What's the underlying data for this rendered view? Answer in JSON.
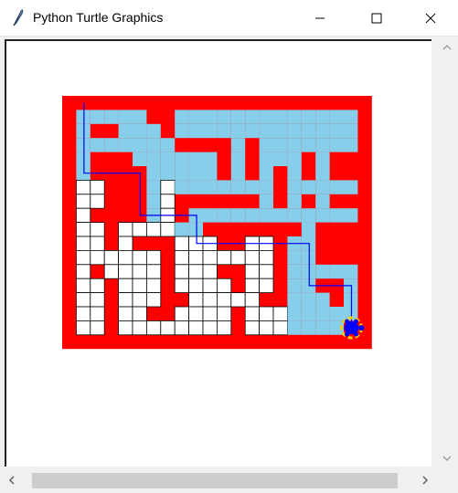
{
  "window": {
    "title": "Python Turtle Graphics",
    "icon": "feather-icon",
    "controls": [
      "minimize-icon",
      "maximize-icon",
      "close-icon"
    ]
  },
  "maze": {
    "rows": 18,
    "cols": 22,
    "grid": [
      "......................",
      "......................",
      "......................",
      "......................",
      "......................",
      "......................",
      "......................",
      "......................",
      "......................",
      "......................",
      "......................",
      "......................",
      "......................",
      "......................",
      "......................",
      "......................",
      "......................",
      "......................"
    ],
    "colors": {
      "wall": "#ff0000",
      "visited": "#87ceeb",
      "unvisited": "#ffffff",
      "grid_line": "#000000",
      "path": "#0000ff",
      "turtle_fill": "#0000ff",
      "turtle_outline": "#ffcc00"
    },
    "solution_path": [
      [
        1,
        0
      ],
      [
        1,
        5
      ],
      [
        5,
        5
      ],
      [
        5,
        8
      ],
      [
        9,
        8
      ],
      [
        9,
        10
      ],
      [
        17,
        10
      ],
      [
        17,
        13
      ],
      [
        20,
        13
      ],
      [
        20,
        16
      ]
    ],
    "turtle": {
      "col": 20,
      "row": 16,
      "heading": "east"
    }
  },
  "scrollbars": {
    "vertical": {
      "up_icon": "chevron-up-icon",
      "down_icon": "chevron-down-icon"
    },
    "horizontal": {
      "left_icon": "chevron-left-icon",
      "right_icon": "chevron-right-icon"
    }
  }
}
